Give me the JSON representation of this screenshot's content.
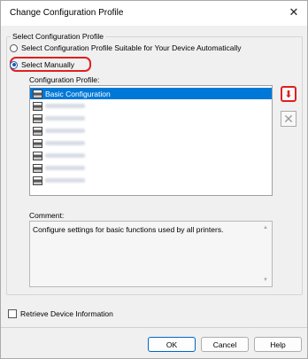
{
  "window": {
    "title": "Change Configuration Profile"
  },
  "group": {
    "label": "Select Configuration Profile"
  },
  "radios": [
    {
      "label": "Select Configuration Profile Suitable for Your Device Automatically",
      "checked": false
    },
    {
      "label": "Select Manually",
      "checked": true
    }
  ],
  "profile": {
    "label": "Configuration Profile:",
    "items": [
      {
        "label": "Basic Configuration",
        "selected": true,
        "icon": "printer-icon"
      },
      {
        "label": "",
        "icon": "printer-icon"
      },
      {
        "label": "",
        "icon": "printer-icon"
      },
      {
        "label": "",
        "icon": "printer-icon"
      },
      {
        "label": "",
        "icon": "printer-icon"
      },
      {
        "label": "",
        "icon": "printer-icon"
      },
      {
        "label": "",
        "icon": "printer-icon"
      },
      {
        "label": "",
        "icon": "printer-icon"
      }
    ]
  },
  "comment": {
    "label": "Comment:",
    "text": "Configure settings for basic functions used by all printers."
  },
  "retrieve": {
    "label": "Retrieve Device Information",
    "checked": false
  },
  "buttons": {
    "ok": "OK",
    "cancel": "Cancel",
    "help": "Help"
  },
  "colors": {
    "accent": "#0078d7",
    "highlight": "#e02020"
  }
}
